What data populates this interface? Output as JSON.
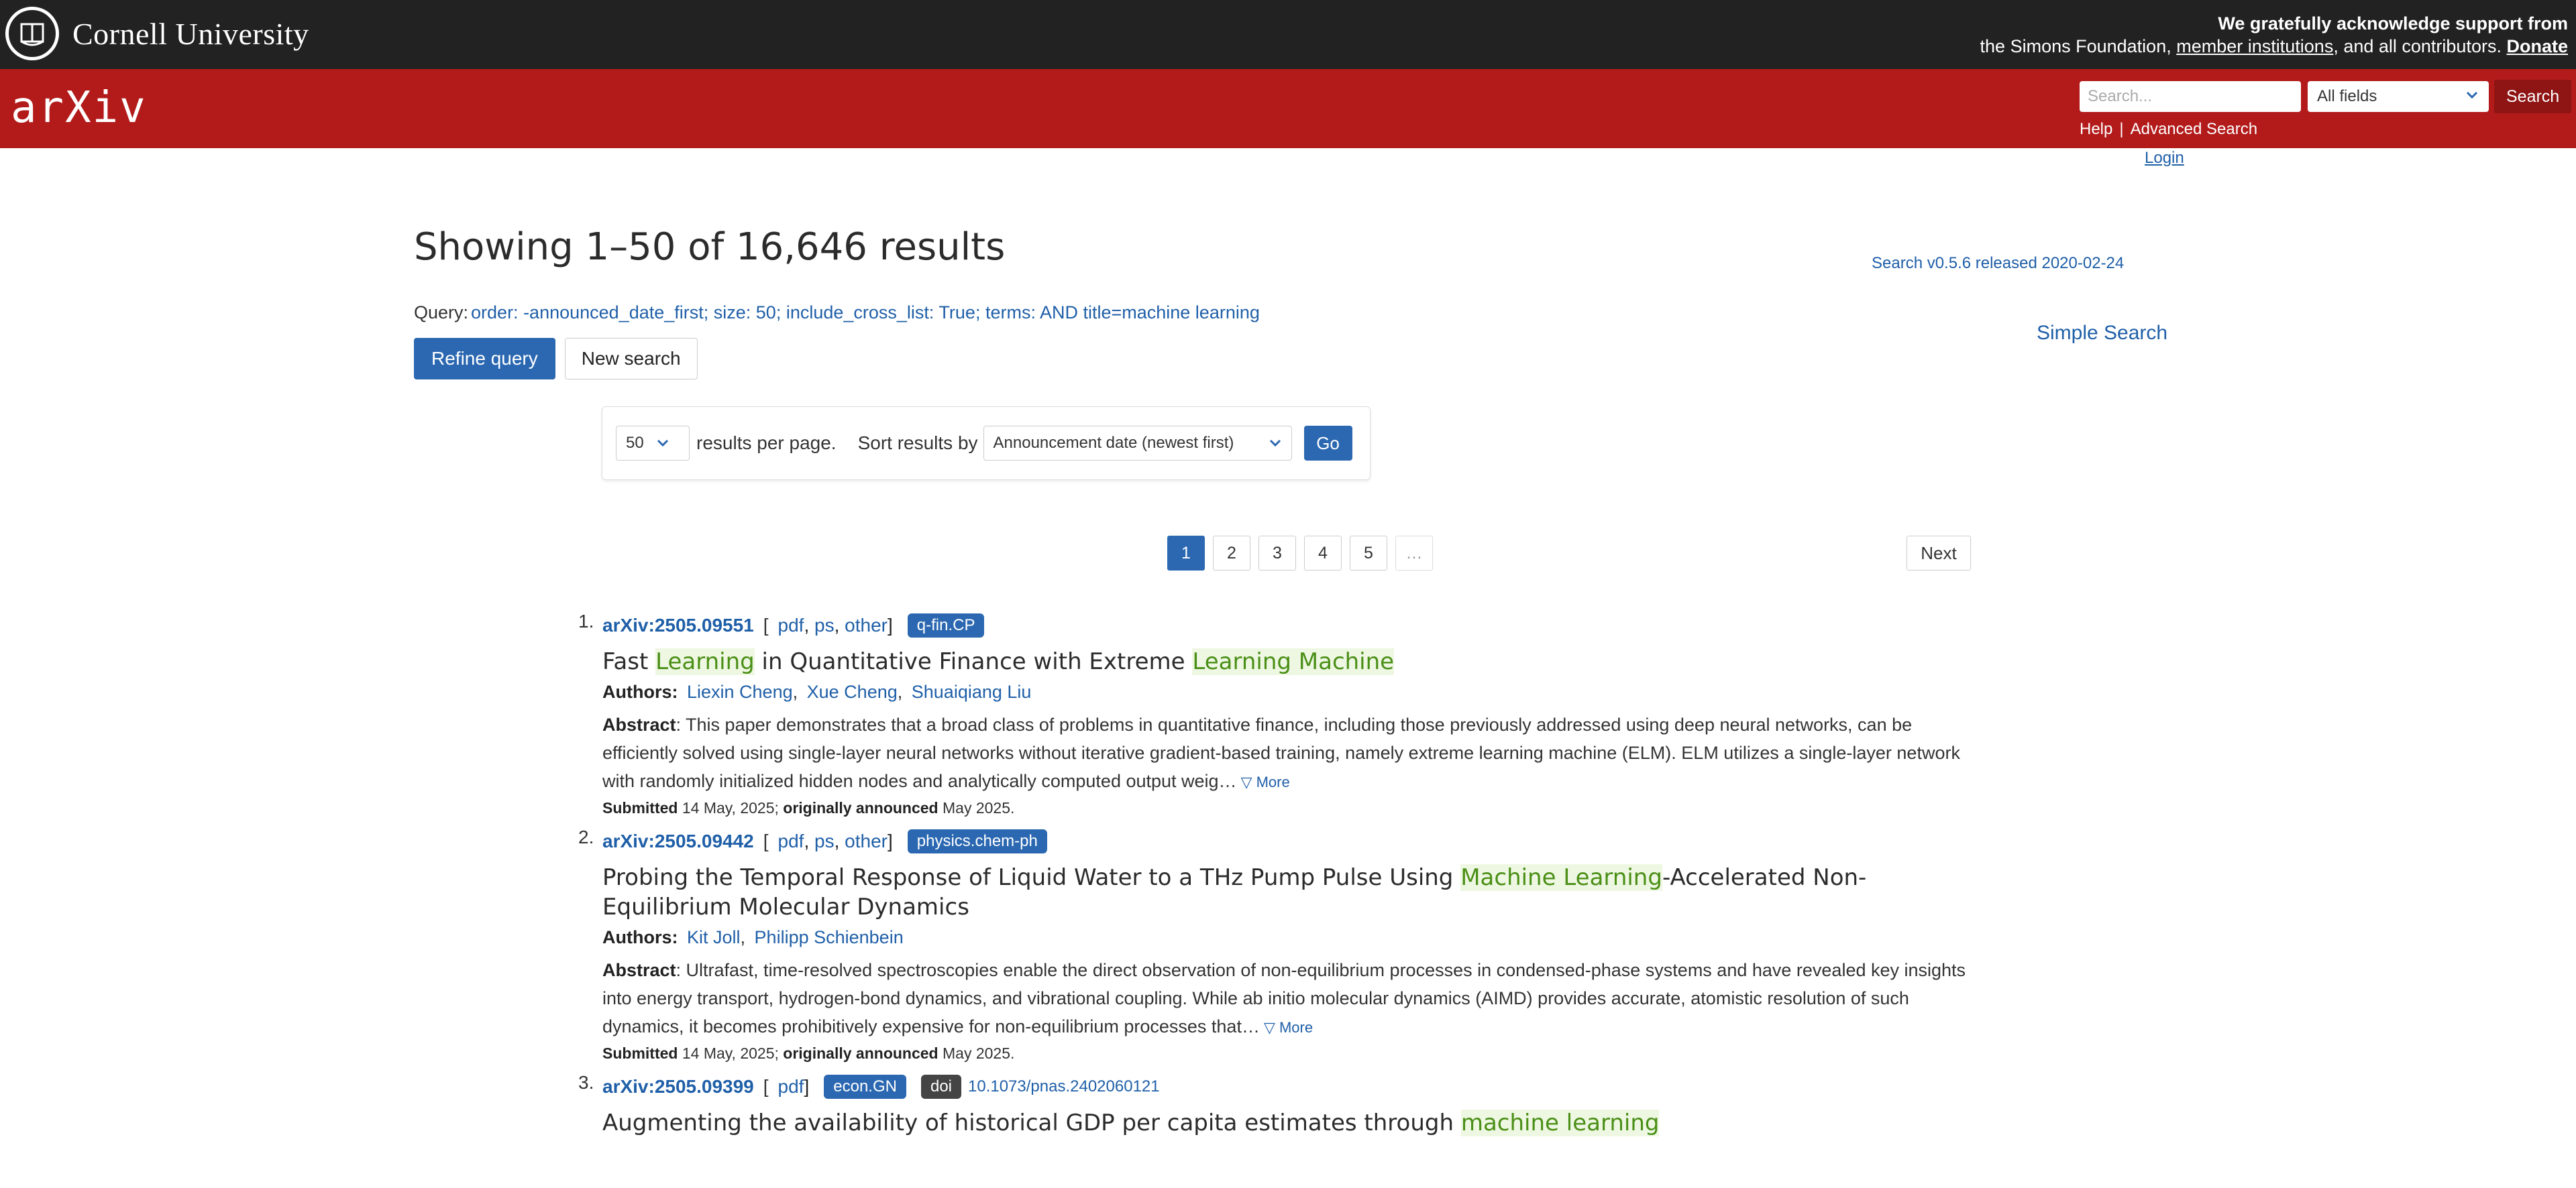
{
  "topbar": {
    "institution": "Cornell University",
    "ack_first": "We gratefully acknowledge support from",
    "ack_middle": "the Simons Foundation,",
    "member_link": "member institutions",
    "ack_end": ", and all contributors.",
    "donate": "Donate"
  },
  "header": {
    "logo_text": "arXiv",
    "search_placeholder": "Search...",
    "field_select": "All fields",
    "search_button": "Search",
    "help": "Help",
    "separator": "|",
    "advanced": "Advanced Search",
    "login": "Login"
  },
  "main": {
    "heading": "Showing 1–50 of 16,646 results",
    "release": "Search v0.5.6 released 2020-02-24",
    "query_label": "Query:",
    "query_text": "order: -announced_date_first; size: 50; include_cross_list: True; terms: AND title=machine learning",
    "refine": "Refine query",
    "new_search": "New search",
    "simple_search": "Simple Search"
  },
  "sort": {
    "per_page": "50",
    "per_page_label": "results per page.",
    "sort_label": "Sort results by",
    "sort_value": "Announcement date (newest first)",
    "go": "Go"
  },
  "pagination": {
    "pages": [
      "1",
      "2",
      "3",
      "4",
      "5",
      "…"
    ],
    "current": "1",
    "next": "Next"
  },
  "results": [
    {
      "num": "1.",
      "id": "arXiv:2505.09551",
      "formats": [
        "pdf",
        "ps",
        "other"
      ],
      "category": "q-fin.CP",
      "title_a": "Fast ",
      "title_h1": "Learning",
      "title_b": " in Quantitative Finance with Extreme ",
      "title_h2": "Learning Machine",
      "title_c": "",
      "authors_label": "Authors:",
      "authors": [
        "Liexin Cheng",
        "Xue Cheng",
        "Shuaiqiang Liu"
      ],
      "abstract_label": "Abstract",
      "abstract": ": This paper demonstrates that a broad class of problems in quantitative finance, including those previously addressed using deep neural networks, can be efficiently solved using single-layer neural networks without iterative gradient-based training, namely extreme learning machine (ELM). ELM utilizes a single-layer network with randomly initialized hidden nodes and analytically computed output weig…",
      "more": "▽ More",
      "submitted_label": "Submitted",
      "submitted": " 14 May, 2025; ",
      "announced_label": "originally announced",
      "announced": " May 2025."
    },
    {
      "num": "2.",
      "id": "arXiv:2505.09442",
      "formats": [
        "pdf",
        "ps",
        "other"
      ],
      "category": "physics.chem-ph",
      "title_a": "Probing the Temporal Response of Liquid Water to a THz Pump Pulse Using ",
      "title_h1": "Machine Learning",
      "title_b": "-Accelerated Non-Equilibrium Molecular Dynamics",
      "title_h2": "",
      "title_c": "",
      "authors_label": "Authors:",
      "authors": [
        "Kit Joll",
        "Philipp Schienbein"
      ],
      "abstract_label": "Abstract",
      "abstract": ": Ultrafast, time-resolved spectroscopies enable the direct observation of non-equilibrium processes in condensed-phase systems and have revealed key insights into energy transport, hydrogen-bond dynamics, and vibrational coupling. While ab initio molecular dynamics (AIMD) provides accurate, atomistic resolution of such dynamics, it becomes prohibitively expensive for non-equilibrium processes that…",
      "more": "▽ More",
      "submitted_label": "Submitted",
      "submitted": " 14 May, 2025; ",
      "announced_label": "originally announced",
      "announced": " May 2025."
    },
    {
      "num": "3.",
      "id": "arXiv:2505.09399",
      "formats": [
        "pdf"
      ],
      "category": "econ.GN",
      "doi_badge": "doi",
      "doi": "10.1073/pnas.2402060121",
      "title_a": "Augmenting the availability of historical GDP per capita estimates through ",
      "title_h1": "machine learning",
      "title_b": "",
      "title_h2": "",
      "title_c": ""
    }
  ],
  "colors": {
    "topbar": "#222222",
    "header_red": "#b31b1b",
    "link_blue": "#1f5fa8",
    "button_blue": "#2b68b1",
    "highlight_green": "#4a8f16"
  }
}
